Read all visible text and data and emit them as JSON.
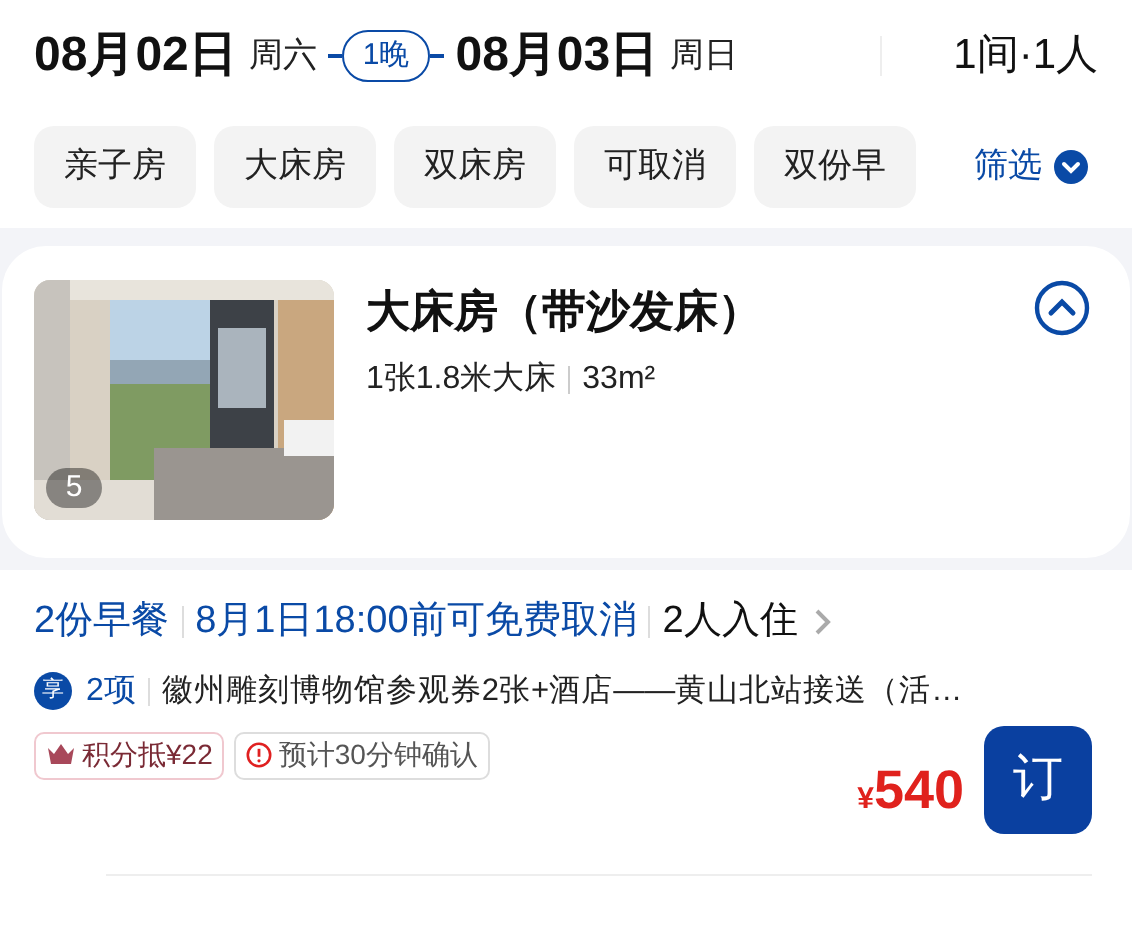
{
  "header": {
    "checkin": {
      "date": "08月02日",
      "weekday": "周六"
    },
    "nights": "1晚",
    "checkout": {
      "date": "08月03日",
      "weekday": "周日"
    },
    "guests": "1间·1人"
  },
  "filters": {
    "chips": [
      {
        "label": "亲子房",
        "selected": false
      },
      {
        "label": "大床房",
        "selected": false
      },
      {
        "label": "双床房",
        "selected": false
      },
      {
        "label": "可取消",
        "selected": false
      },
      {
        "label": "双份早",
        "selected": false
      }
    ],
    "filter_button": "筛选"
  },
  "room": {
    "name": "大床房（带沙发床）",
    "bed": "1张1.8米大床",
    "area": "33m²",
    "photo_count": "5",
    "expanded": true
  },
  "offer": {
    "breakfast": "2份早餐",
    "cancel": "8月1日18:00前可免费取消",
    "occupancy": "2人入住",
    "perk_badge": "享",
    "perk_count": "2项",
    "perk_text": "徽州雕刻博物馆参观券2张+酒店——黄山北站接送（活…",
    "tags": [
      {
        "kind": "points",
        "label": "积分抵¥22"
      },
      {
        "kind": "confirm",
        "label": "预计30分钟确认"
      }
    ],
    "currency": "¥",
    "price": "540",
    "book_button": "订"
  }
}
